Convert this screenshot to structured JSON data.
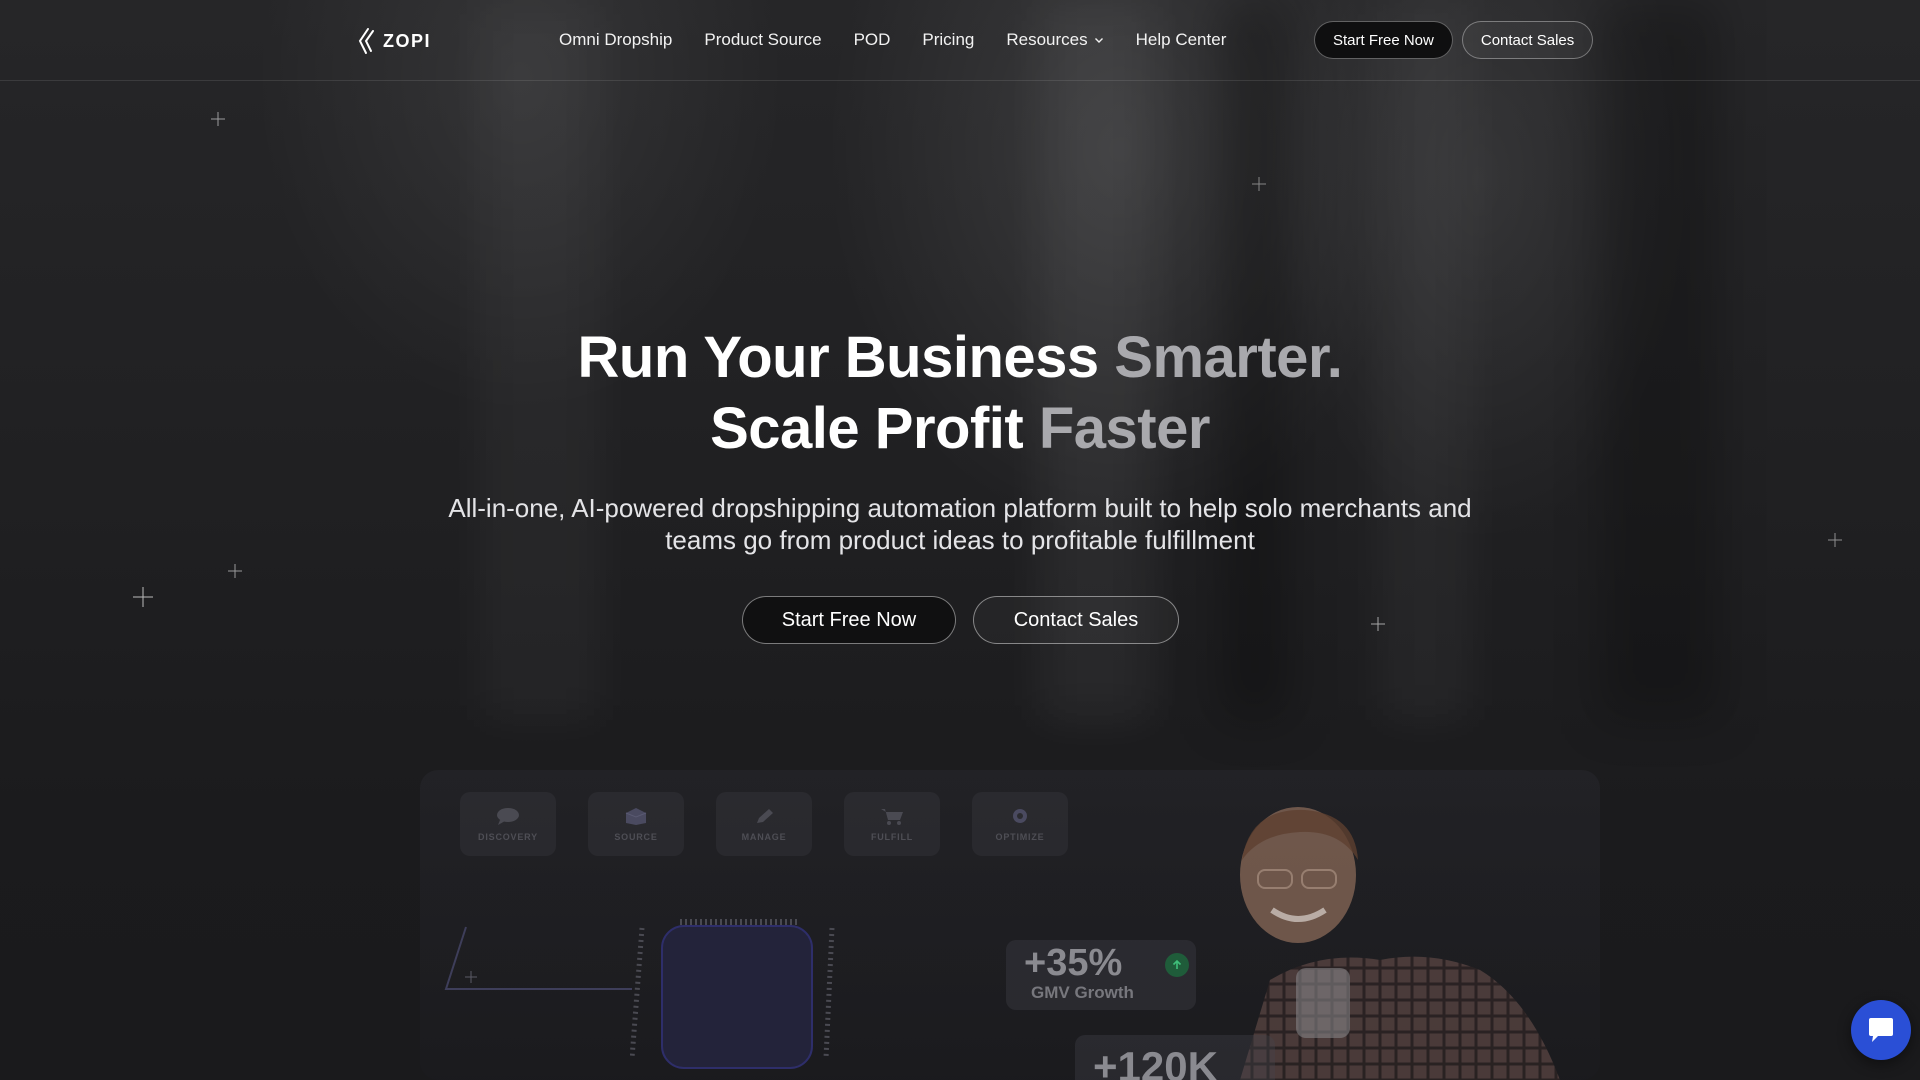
{
  "header": {
    "logo_text": "ZOPI",
    "nav": [
      {
        "label": "Omni Dropship"
      },
      {
        "label": "Product Source"
      },
      {
        "label": "POD"
      },
      {
        "label": "Pricing"
      },
      {
        "label": "Resources",
        "icon": "chevron-down-icon"
      },
      {
        "label": "Help Center"
      }
    ],
    "start_free_label": "Start Free Now",
    "contact_sales_label": "Contact Sales"
  },
  "hero": {
    "title_line1_white": "Run Your Business ",
    "title_line1_gray": "Smarter.",
    "title_line2_white": "Scale Profit ",
    "title_line2_gray": "Faster",
    "subtitle_line1": "All-in-one, AI-powered dropshipping automation platform built to help solo merchants and",
    "subtitle_line2": "teams go from product ideas to profitable fulfillment",
    "start_free_label": "Start Free Now",
    "contact_sales_label": "Contact Sales"
  },
  "preview": {
    "stages": [
      {
        "label": "DISCOVERY",
        "icon": "chat-bubble-icon"
      },
      {
        "label": "SOURCE",
        "icon": "box-icon"
      },
      {
        "label": "MANAGE",
        "icon": "pen-icon"
      },
      {
        "label": "FULFILL",
        "icon": "cart-icon"
      },
      {
        "label": "OPTIMIZE",
        "icon": "gear-icon"
      }
    ],
    "stat_gmv_value": "+35%",
    "stat_gmv_label": "GMV Growth",
    "stat_second_value": "+120K"
  },
  "colors": {
    "background": "#1c1c1e",
    "accent_gray_text": "#a9a9ad",
    "chat_button": "#2a4fd6",
    "growth_badge": "#1f5c3a"
  },
  "chat": {
    "icon": "chat-icon"
  }
}
